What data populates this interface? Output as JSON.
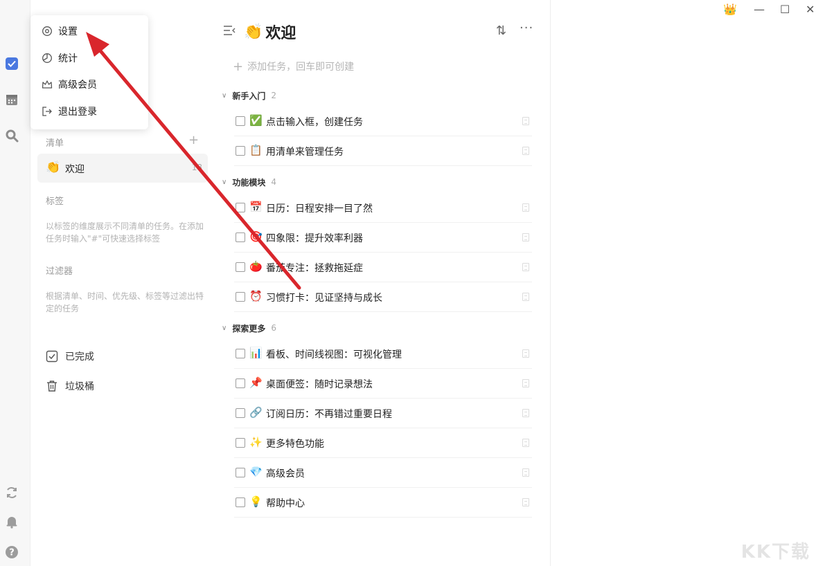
{
  "popup_menu": {
    "items": [
      {
        "label": "设置",
        "icon": "gear-icon"
      },
      {
        "label": "统计",
        "icon": "pie-chart-icon"
      },
      {
        "label": "高级会员",
        "icon": "crown-outline-icon"
      },
      {
        "label": "退出登录",
        "icon": "logout-icon"
      }
    ]
  },
  "sidebar": {
    "lists_title": "清单",
    "list_item": {
      "emoji": "👏",
      "label": "欢迎",
      "count": "18"
    },
    "tags_title": "标签",
    "tags_hint": "以标签的维度展示不同清单的任务。在添加任务时输入\"#\"可快速选择标签",
    "filters_title": "过滤器",
    "filters_hint": "根据清单、时间、优先级、标签等过滤出特定的任务",
    "completed_label": "已完成",
    "trash_label": "垃圾桶"
  },
  "main": {
    "title_emoji": "👏",
    "title": "欢迎",
    "add_task_placeholder": "添加任务，回车即可创建",
    "groups": [
      {
        "name": "新手入门",
        "count": "2"
      },
      {
        "name": "功能模块",
        "count": "4"
      },
      {
        "name": "探索更多",
        "count": "6"
      }
    ],
    "tasks": [
      {
        "emoji": "✅",
        "text": "点击输入框，创建任务"
      },
      {
        "emoji": "📋",
        "text": "用清单来管理任务"
      },
      {
        "emoji": "📅",
        "text": "日历：日程安排一目了然"
      },
      {
        "emoji": "🎯",
        "text": "四象限：提升效率利器"
      },
      {
        "emoji": "🍅",
        "text": "番茄专注：拯救拖延症"
      },
      {
        "emoji": "⏰",
        "text": "习惯打卡：见证坚持与成长"
      },
      {
        "emoji": "📊",
        "text": "看板、时间线视图：可视化管理"
      },
      {
        "emoji": "📌",
        "text": "桌面便签：随时记录想法"
      },
      {
        "emoji": "🔗",
        "text": "订阅日历：不再错过重要日程"
      },
      {
        "emoji": "✨",
        "text": "更多特色功能"
      },
      {
        "emoji": "💎",
        "text": "高级会员"
      },
      {
        "emoji": "💡",
        "text": "帮助中心"
      }
    ]
  },
  "window": {
    "crown_icon": "👑",
    "minimize": "—",
    "maximize": "☐",
    "close": "✕"
  },
  "watermark": "KK下载",
  "colors": {
    "accent": "#4a78e0",
    "annotation_arrow": "#d9262c",
    "crown": "#f5a623"
  }
}
